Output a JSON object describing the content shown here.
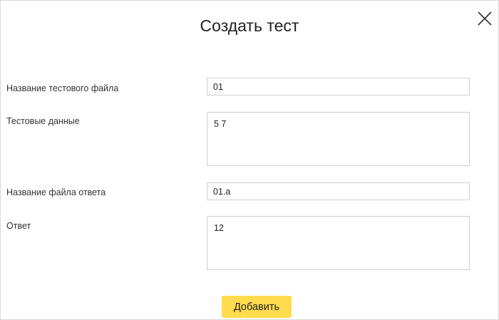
{
  "dialog": {
    "title": "Создать тест",
    "close_icon": "close-icon"
  },
  "form": {
    "test_file_name": {
      "label": "Название тестового файла",
      "value": "01"
    },
    "test_data": {
      "label": "Тестовые данные",
      "value": "5 7"
    },
    "answer_file_name": {
      "label": "Название файла ответа",
      "value": "01.a"
    },
    "answer": {
      "label": "Ответ",
      "value": "12"
    }
  },
  "actions": {
    "add_label": "Добавить",
    "add_color": "#ffdb4d"
  }
}
